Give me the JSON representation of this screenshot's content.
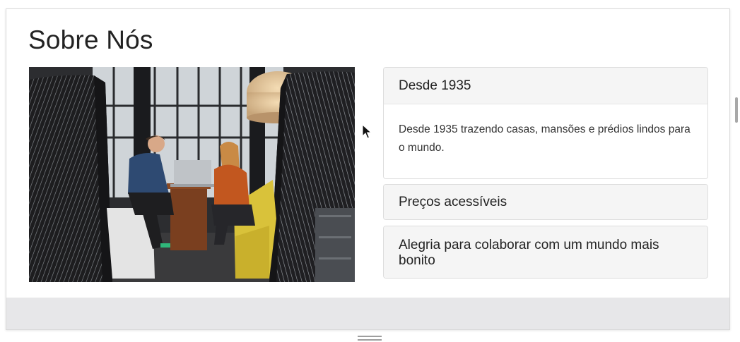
{
  "page": {
    "title": "Sobre Nós"
  },
  "photo": {
    "description_icon": "office-meeting-photo",
    "colors": {
      "window_light": "#d9dde0",
      "frame_dark": "#1c1c1e",
      "sofa_yellow": "#d9c23a",
      "sofa_white": "#e4e4e4",
      "lamp": "#e8c99b",
      "table_wood": "#7a3f1f"
    }
  },
  "accordion": {
    "items": [
      {
        "title": "Desde 1935",
        "body": "Desde 1935 trazendo casas, mansões e prédios lindos para o mundo.",
        "expanded": true
      },
      {
        "title": "Preços acessíveis",
        "expanded": false
      },
      {
        "title": "Alegria para colaborar com um mundo mais bonito",
        "expanded": false
      }
    ]
  },
  "colors": {
    "panel_heading_bg": "#f5f5f5",
    "panel_border": "#dddddd",
    "footer_band": "#e7e7e9",
    "text": "#222222"
  }
}
